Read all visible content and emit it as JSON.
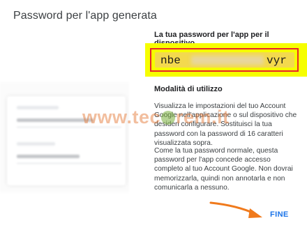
{
  "dialog": {
    "title": "Password per l'app generata"
  },
  "password_section": {
    "label": "La tua password per l'app per il dispositivo",
    "visible_start": "nbe",
    "visible_end": "vyr"
  },
  "usage": {
    "title": "Modalità di utilizzo",
    "paragraph1": "Visualizza le impostazioni del tuo Account Google nell'applicazione o sul dispositivo che desideri configurare. Sostituisci la tua password con la password di 16 caratteri visualizzata sopra.",
    "paragraph2": "Come la tua password normale, questa password per l'app concede accesso completo al tuo Account Google. Non dovrai memorizzarla, quindi non annotarla e non comunicarla a nessuno."
  },
  "watermark": {
    "text_before": "www.tec",
    "text_after": "rem.it"
  },
  "actions": {
    "done_label": "FINE"
  },
  "colors": {
    "highlight": "#f6fe00",
    "frame": "#e8242a",
    "accent": "#1a73e8",
    "arrow": "#f07a1c"
  }
}
